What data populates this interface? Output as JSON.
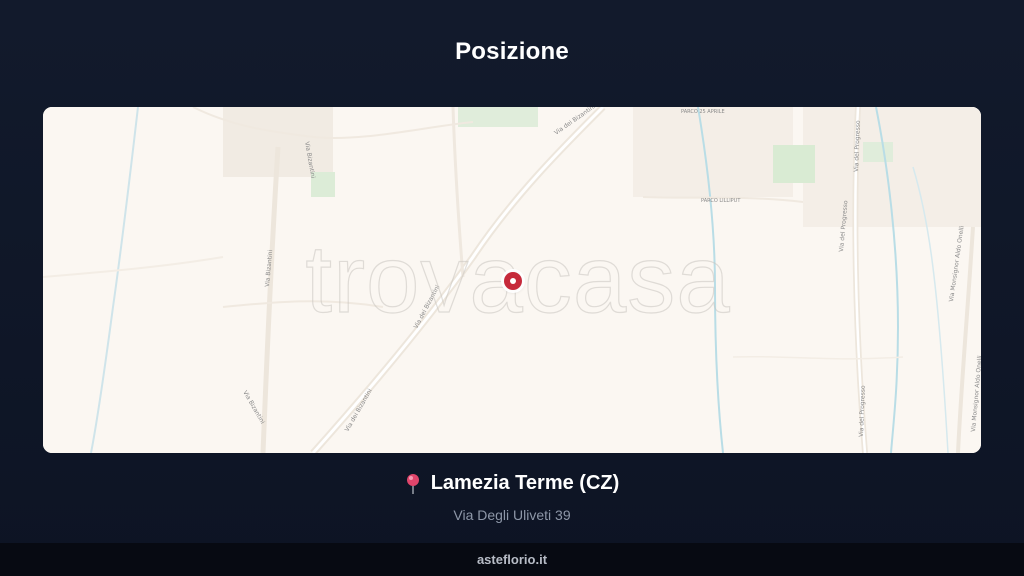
{
  "header": {
    "title": "Posizione"
  },
  "map": {
    "watermark": "trovacasa",
    "street_labels": [
      "Via dei Bizantini",
      "Via dei Bizantini",
      "Via dei Bizantini",
      "Via Bizantini",
      "Via Bizantini",
      "Via Bizantini",
      "Via del Progresso",
      "Via del Progresso",
      "Via del Progresso",
      "Via Monsignor Aldo Onelli",
      "Via Monsignor Aldo Onelli"
    ],
    "place_labels": [
      "PARCO 25 APRILE",
      "PARCO LILLIPUT"
    ],
    "colors": {
      "background": "#fbf7f2",
      "marker": "#c62a3b"
    }
  },
  "location": {
    "city": "Lamezia Terme (CZ)",
    "address": "Via Degli Uliveti 39",
    "icon": "map-pin-icon"
  },
  "footer": {
    "site": "asteflorio.it"
  },
  "colors": {
    "page_background": "#121a2c",
    "footer_background": "#070a12",
    "address_text": "#8e97a8"
  }
}
